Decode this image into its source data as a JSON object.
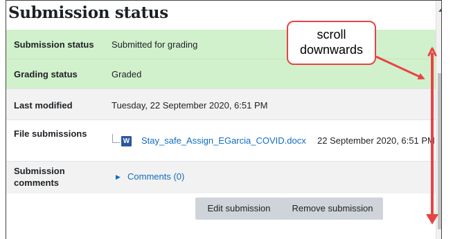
{
  "section": {
    "title": "Submission status"
  },
  "rows": [
    {
      "label": "Submission status",
      "value": "Submitted for grading"
    },
    {
      "label": "Grading status",
      "value": "Graded"
    },
    {
      "label": "Last modified",
      "value": "Tuesday, 22 September 2020, 6:51 PM"
    },
    {
      "label": "File submissions"
    },
    {
      "label": "Submission\ncomments"
    }
  ],
  "file": {
    "icon": "word-doc-icon",
    "name": "Stay_safe_Assign_EGarcia_COVID.docx",
    "date": "22 September 2020, 6:51 PM"
  },
  "comments": {
    "link": "Comments (0)"
  },
  "buttons": {
    "edit": "Edit submission",
    "remove": "Remove submission"
  },
  "annotation": {
    "line1": "scroll",
    "line2": "downwards",
    "color": "#e84343"
  },
  "colors": {
    "submitted_row": "#d1f0cc",
    "link": "#0f6cbf",
    "button": "#ced4da"
  }
}
